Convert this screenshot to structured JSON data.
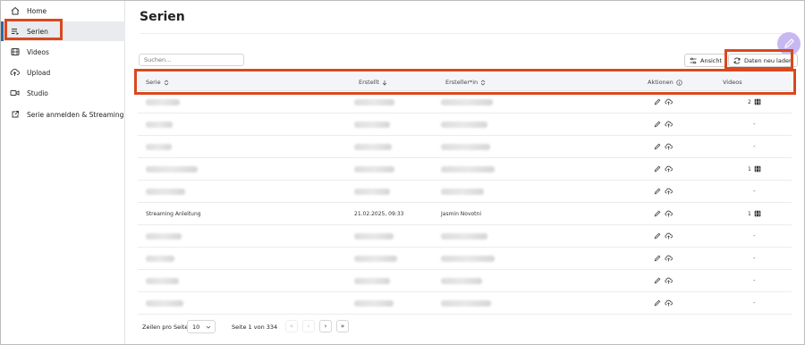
{
  "sidebar": {
    "items": [
      {
        "label": "Home",
        "icon": "home-icon"
      },
      {
        "label": "Serien",
        "icon": "series-list-icon",
        "active": true
      },
      {
        "label": "Videos",
        "icon": "film-icon"
      },
      {
        "label": "Upload",
        "icon": "upload-cloud-icon"
      },
      {
        "label": "Studio",
        "icon": "video-camera-icon"
      },
      {
        "label": "Serie anmelden & Streaming",
        "icon": "external-link-icon"
      }
    ]
  },
  "page": {
    "title": "Serien"
  },
  "toolbar": {
    "search_placeholder": "Suchen...",
    "view_label": "Ansicht",
    "reload_label": "Daten neu laden"
  },
  "table": {
    "headers": {
      "serie": "Serie",
      "erstellt": "Erstellt",
      "ersteller": "Ersteller*in",
      "aktionen": "Aktionen",
      "videos": "Videos"
    },
    "rows": [
      {
        "serie": "",
        "erstellt": "",
        "ersteller": "",
        "videos": "2"
      },
      {
        "serie": "",
        "erstellt": "",
        "ersteller": "",
        "videos": "-"
      },
      {
        "serie": "",
        "erstellt": "",
        "ersteller": "",
        "videos": "-"
      },
      {
        "serie": "",
        "erstellt": "",
        "ersteller": "",
        "videos": "1"
      },
      {
        "serie": "",
        "erstellt": "",
        "ersteller": "",
        "videos": "-"
      },
      {
        "serie": "Streaming Anleitung",
        "erstellt": "21.02.2025, 09:33",
        "ersteller": "Jasmin Novotni",
        "videos": "1"
      },
      {
        "serie": "",
        "erstellt": "",
        "ersteller": "",
        "videos": "-"
      },
      {
        "serie": "",
        "erstellt": "",
        "ersteller": "",
        "videos": "-"
      },
      {
        "serie": "",
        "erstellt": "",
        "ersteller": "",
        "videos": "-"
      },
      {
        "serie": "",
        "erstellt": "",
        "ersteller": "",
        "videos": "-"
      }
    ]
  },
  "pagination": {
    "rows_per_page_label": "Zeilen pro Seite",
    "rows_per_page_value": "10",
    "page_info": "Seite 1 von 334"
  },
  "colors": {
    "highlight": "#d9481f",
    "active_bar": "#2b6aa3",
    "fab": "#c8b8f2"
  }
}
